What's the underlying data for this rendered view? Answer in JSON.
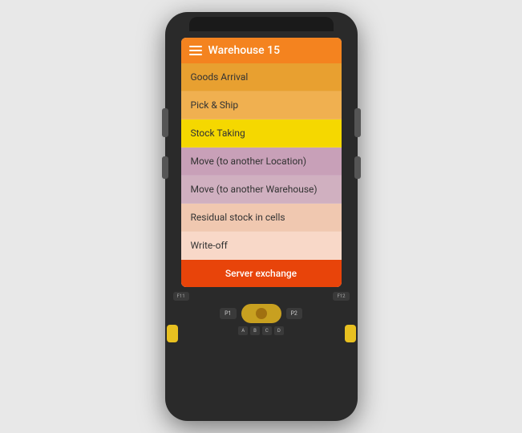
{
  "header": {
    "title": "Warehouse 15",
    "menu_icon": "hamburger"
  },
  "menu_items": [
    {
      "id": "goods-arrival",
      "label": "Goods Arrival",
      "bg": "#E8A030",
      "color": "#333"
    },
    {
      "id": "pick-ship",
      "label": "Pick & Ship",
      "bg": "#F0B050",
      "color": "#333"
    },
    {
      "id": "stock-taking",
      "label": "Stock Taking",
      "bg": "#F5D800",
      "color": "#333"
    },
    {
      "id": "move-location",
      "label": "Move (to another Location)",
      "bg": "#C8A0B8",
      "color": "#333"
    },
    {
      "id": "move-warehouse",
      "label": "Move (to another Warehouse)",
      "bg": "#D0B0C0",
      "color": "#333"
    },
    {
      "id": "residual-stock",
      "label": "Residual stock in cells",
      "bg": "#F0C8B0",
      "color": "#333"
    },
    {
      "id": "write-off",
      "label": "Write-off",
      "bg": "#F8D8C8",
      "color": "#333"
    }
  ],
  "server_exchange": {
    "label": "Server exchange",
    "bg": "#E8440A",
    "color": "#ffffff"
  },
  "device": {
    "fn_keys": [
      "F11",
      "F12"
    ],
    "p_keys": [
      "P1",
      "P2"
    ],
    "alpha_keys": [
      "A",
      "B",
      "C",
      "D"
    ]
  }
}
